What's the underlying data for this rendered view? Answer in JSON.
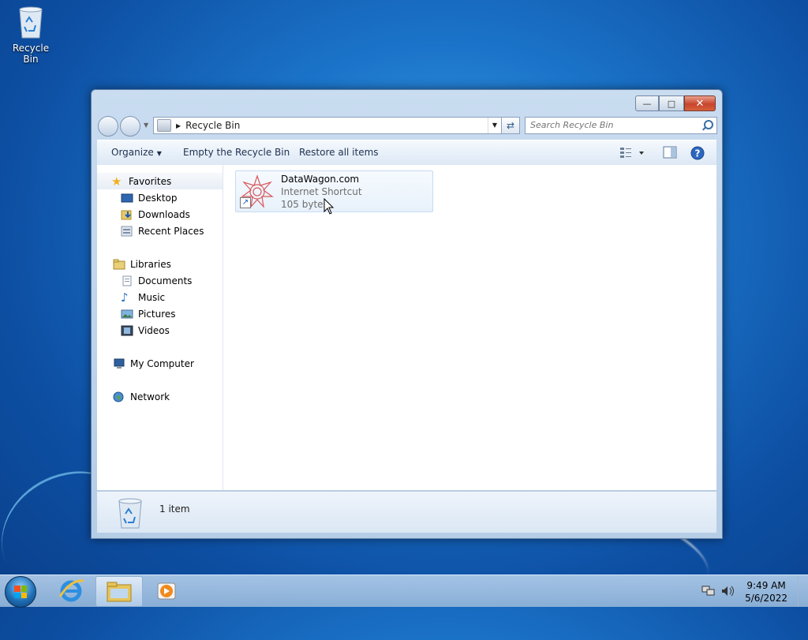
{
  "desktop": {
    "icons": [
      {
        "label": "Recycle Bin",
        "icon": "recycle-bin-icon"
      }
    ]
  },
  "window": {
    "caption_buttons": {
      "minimize": "minimize-icon",
      "maximize": "maximize-icon",
      "close": "close-icon"
    },
    "address": {
      "location": "Recycle Bin"
    },
    "search": {
      "placeholder": "Search Recycle Bin"
    },
    "toolbar": {
      "organize": "Organize",
      "empty": "Empty the Recycle Bin",
      "restore": "Restore all items"
    },
    "nav": {
      "favorites": {
        "label": "Favorites",
        "items": [
          "Desktop",
          "Downloads",
          "Recent Places"
        ]
      },
      "libraries": {
        "label": "Libraries",
        "items": [
          "Documents",
          "Music",
          "Pictures",
          "Videos"
        ]
      },
      "computer": "My Computer",
      "network": "Network"
    },
    "files": [
      {
        "name": "DataWagon.com",
        "type": "Internet Shortcut",
        "size": "105 bytes"
      }
    ],
    "status": {
      "count": "1 item"
    }
  },
  "taskbar": {
    "clock": {
      "time": "9:49 AM",
      "date": "5/6/2022"
    },
    "pinned": [
      "internet-explorer-icon",
      "windows-explorer-icon",
      "media-player-icon"
    ]
  }
}
